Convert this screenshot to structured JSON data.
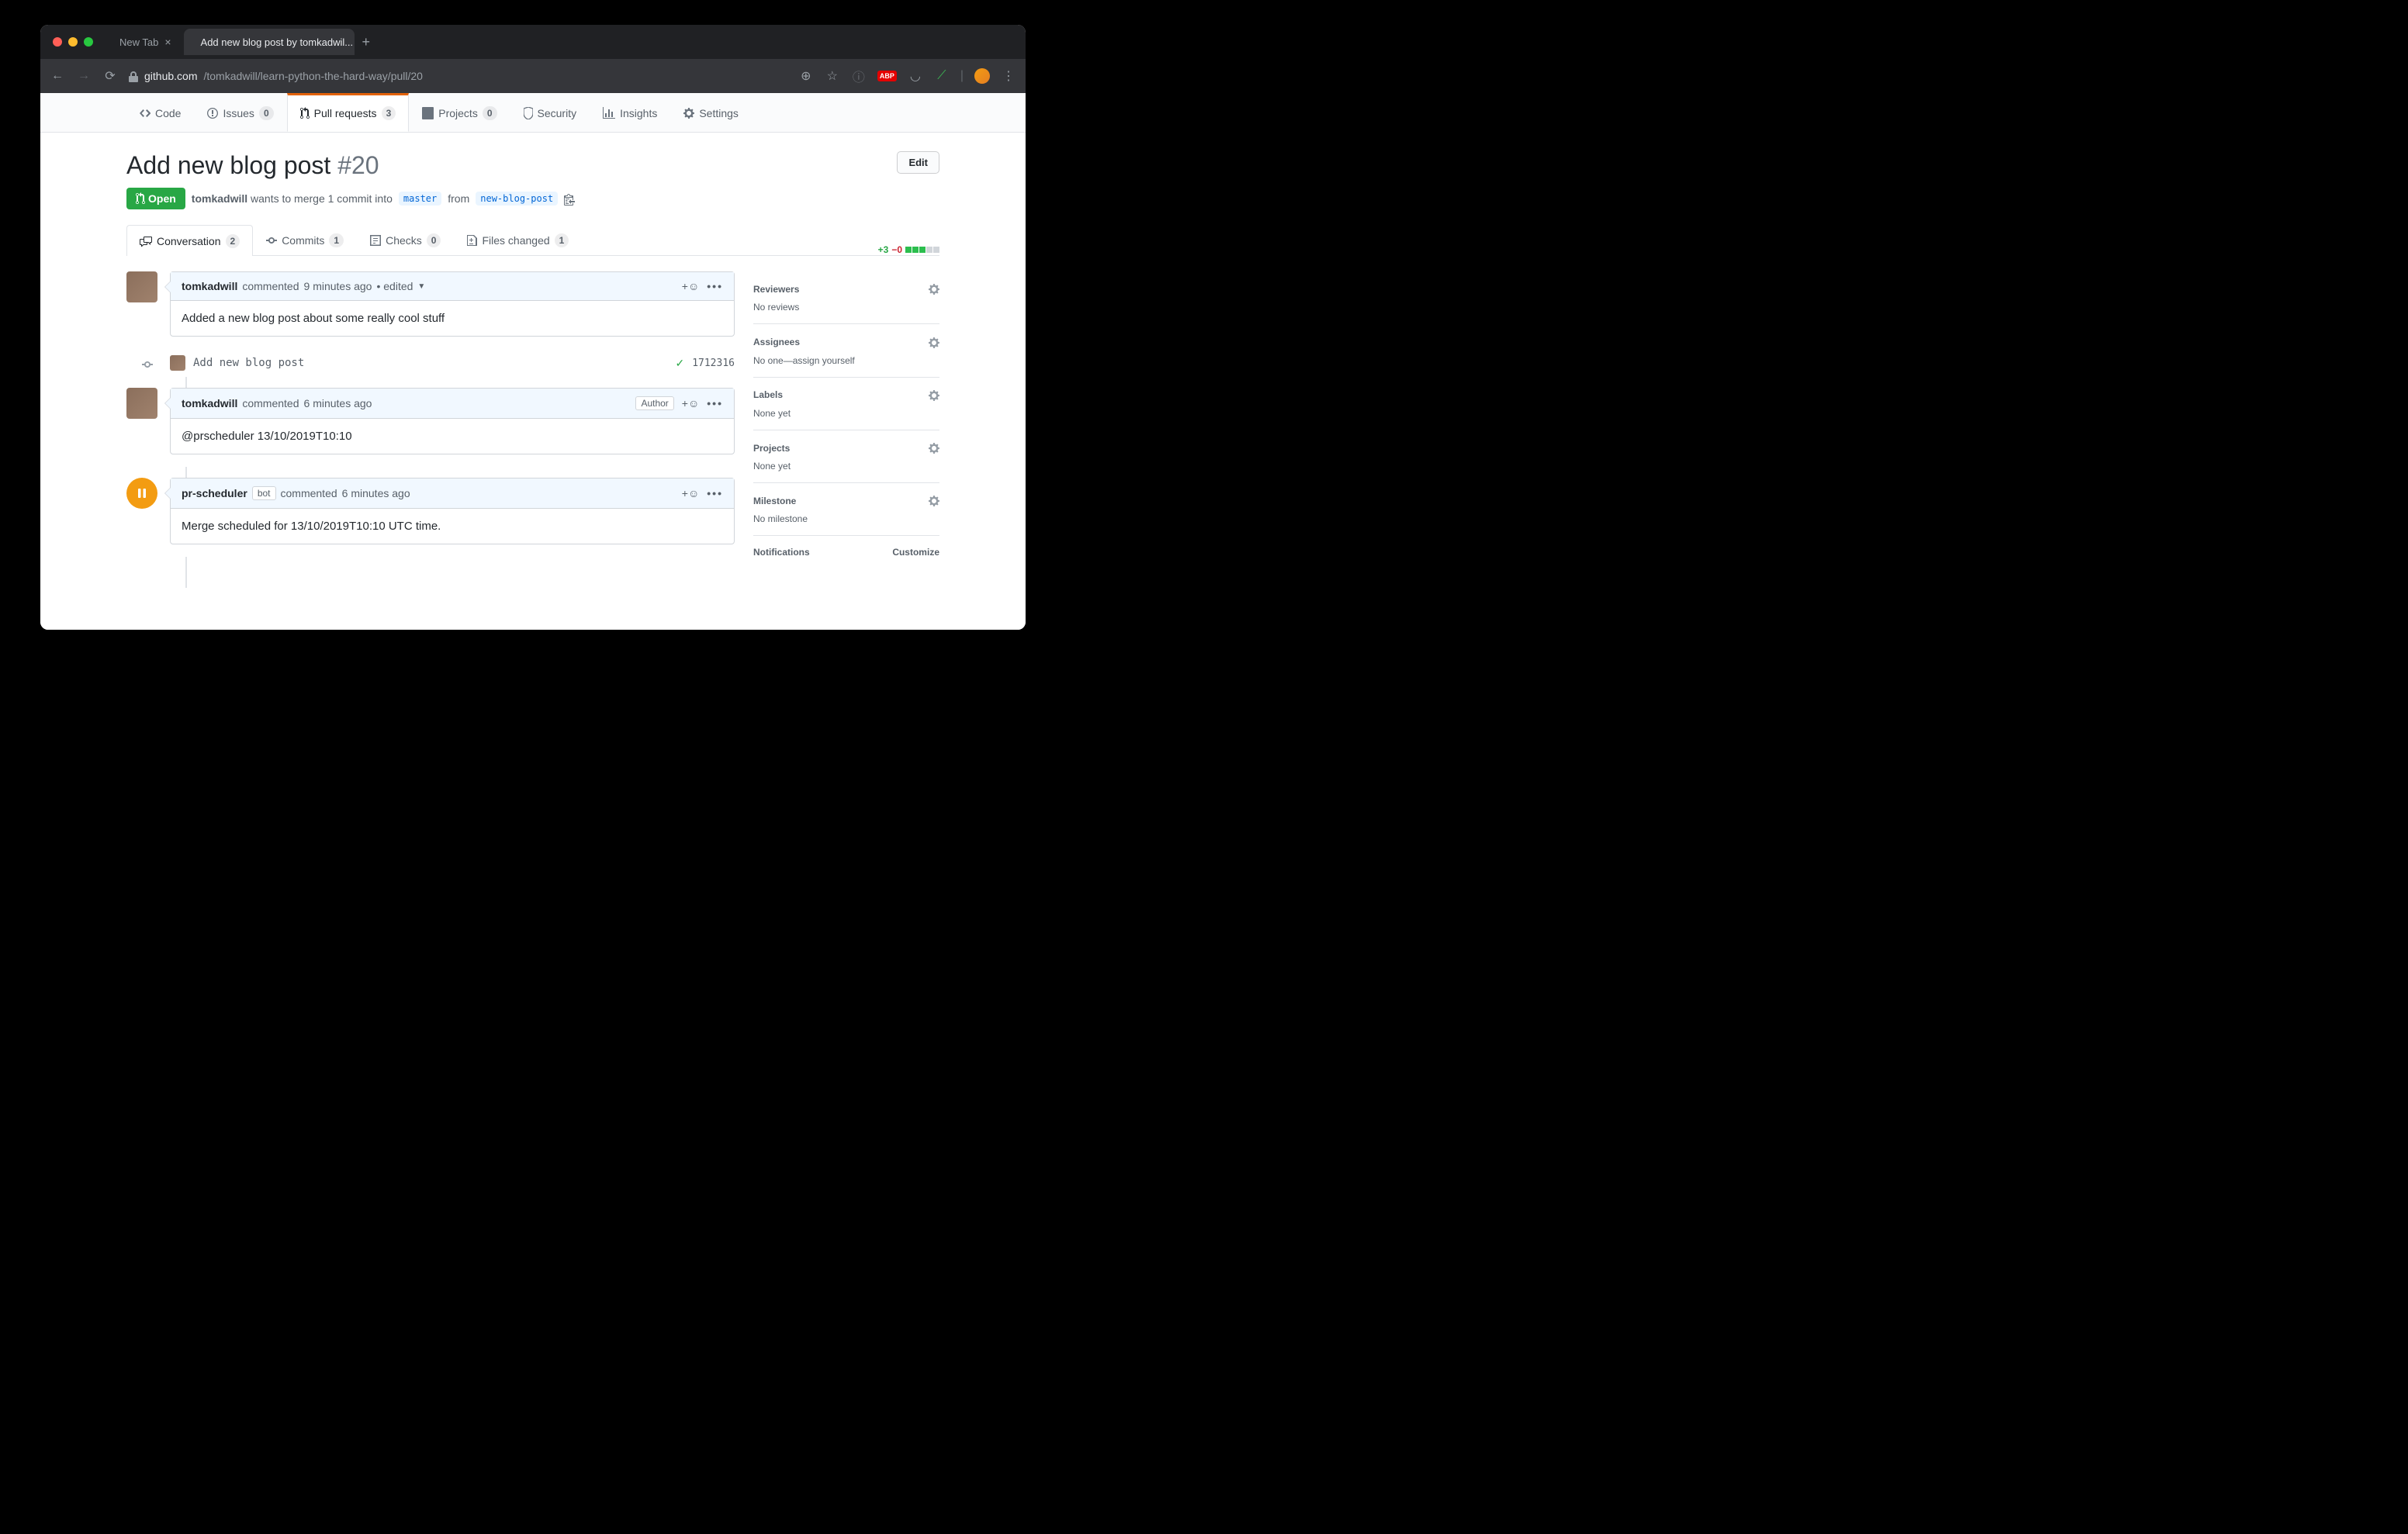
{
  "browser": {
    "tabs": [
      {
        "title": "New Tab"
      },
      {
        "title": "Add new blog post by tomkadwil..."
      }
    ],
    "url_host": "github.com",
    "url_path": "/tomkadwill/learn-python-the-hard-way/pull/20"
  },
  "reponav": {
    "code": "Code",
    "issues": "Issues",
    "issues_count": "0",
    "pulls": "Pull requests",
    "pulls_count": "3",
    "projects": "Projects",
    "projects_count": "0",
    "security": "Security",
    "insights": "Insights",
    "settings": "Settings"
  },
  "pr": {
    "title": "Add new blog post",
    "number": "#20",
    "edit_btn": "Edit",
    "state": "Open",
    "author": "tomkadwill",
    "merge_text_1": "wants to merge 1 commit into",
    "base_branch": "master",
    "merge_text_2": "from",
    "head_branch": "new-blog-post"
  },
  "tabs": {
    "conversation": "Conversation",
    "conversation_count": "2",
    "commits": "Commits",
    "commits_count": "1",
    "checks": "Checks",
    "checks_count": "0",
    "files": "Files changed",
    "files_count": "1"
  },
  "diffstat": {
    "additions": "+3",
    "deletions": "−0"
  },
  "comments": [
    {
      "author": "tomkadwill",
      "action": "commented",
      "time": "9 minutes ago",
      "edited": "• edited",
      "body": "Added a new blog post about some really cool stuff",
      "author_badge": ""
    },
    {
      "author": "tomkadwill",
      "action": "commented",
      "time": "6 minutes ago",
      "body": "@prscheduler 13/10/2019T10:10",
      "author_badge": "Author"
    },
    {
      "author": "pr-scheduler",
      "bot_badge": "bot",
      "action": "commented",
      "time": "6 minutes ago",
      "body": "Merge scheduled for 13/10/2019T10:10 UTC time."
    }
  ],
  "commit": {
    "message": "Add new blog post",
    "sha": "1712316"
  },
  "sidebar": {
    "reviewers": {
      "title": "Reviewers",
      "body": "No reviews"
    },
    "assignees": {
      "title": "Assignees",
      "body_prefix": "No one—",
      "assign_self": "assign yourself"
    },
    "labels": {
      "title": "Labels",
      "body": "None yet"
    },
    "projects": {
      "title": "Projects",
      "body": "None yet"
    },
    "milestone": {
      "title": "Milestone",
      "body": "No milestone"
    },
    "notifications": {
      "title": "Notifications",
      "customize": "Customize"
    }
  }
}
